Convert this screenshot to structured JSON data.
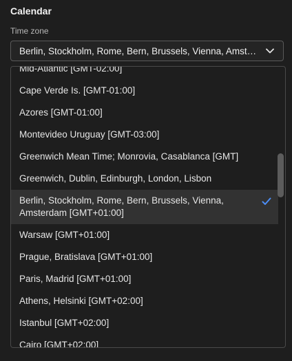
{
  "section": {
    "title": "Calendar"
  },
  "timezone": {
    "label": "Time zone",
    "selected_value": "Berlin, Stockholm, Rome, Bern, Brussels, Vienna, Amsterdam [GMT+01:00]",
    "options": [
      "Mid-Atlantic [GMT-02:00]",
      "Cape Verde Is. [GMT-01:00]",
      "Azores [GMT-01:00]",
      "Montevideo Uruguay [GMT-03:00]",
      "Greenwich Mean Time; Monrovia, Casablanca [GMT]",
      "Greenwich, Dublin, Edinburgh, London, Lisbon",
      "Berlin, Stockholm, Rome, Bern, Brussels, Vienna, Amsterdam [GMT+01:00]",
      "Warsaw [GMT+01:00]",
      "Prague, Bratislava [GMT+01:00]",
      "Paris, Madrid [GMT+01:00]",
      "Athens, Helsinki [GMT+02:00]",
      "Istanbul [GMT+02:00]",
      "Cairo [GMT+02:00]"
    ]
  },
  "colors": {
    "accent": "#4c8ef7",
    "selected_row_bg": "#323232"
  },
  "icons": {
    "dropdown": "chevron-down-icon",
    "selected": "checkmark-icon"
  }
}
